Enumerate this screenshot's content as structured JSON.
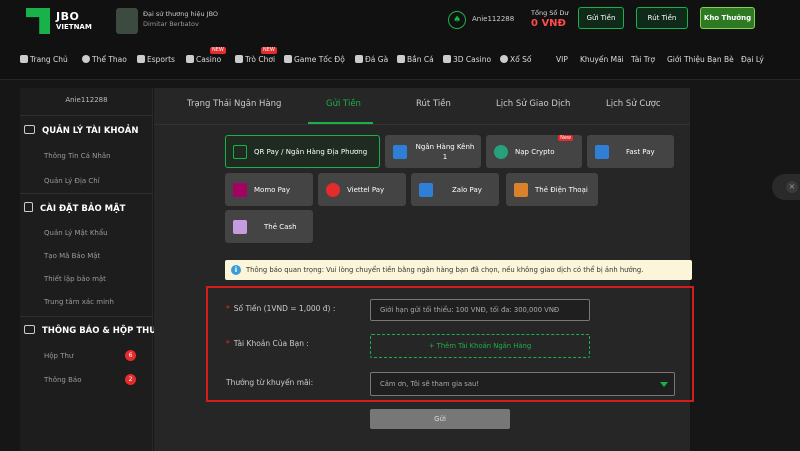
{
  "header": {
    "logo_line1": "JBO",
    "logo_line2": "VIETNAM",
    "ambassador_line1": "Đại sứ thương hiệu JBO",
    "ambassador_line2": "Dimitar Berbatov",
    "username": "Anie112288",
    "balance_label": "Tổng Số Dư",
    "balance_value": "0 VNĐ",
    "deposit_button": "Gửi Tiền",
    "withdraw_button": "Rút Tiền",
    "rewards_button": "Kho Thưởng"
  },
  "nav": {
    "items": [
      "Trang Chủ",
      "Thể Thao",
      "Esports",
      "Casino",
      "Trò Chơi",
      "Game Tốc Độ",
      "Đá Gà",
      "Bắn Cá",
      "3D Casino",
      "Xổ Số",
      "VIP",
      "Khuyến Mãi",
      "Tài Trợ",
      "Giới Thiệu Bạn Bè",
      "Đại Lý"
    ],
    "new_badge": "NEW"
  },
  "sidebar": {
    "username": "Anie112288",
    "section1": "QUẢN LÝ TÀI KHOẢN",
    "section1_items": [
      "Thông Tin Cá Nhân",
      "Quản Lý Địa Chỉ"
    ],
    "section2": "CÀI ĐẶT BẢO MẬT",
    "section2_items": [
      "Quản Lý Mật Khẩu",
      "Tạo Mã Bảo Mật",
      "Thiết lập bảo mật",
      "Trung tâm xác minh"
    ],
    "section3": "THÔNG BÁO & HỘP THƯ",
    "section3_items": [
      "Hộp Thư",
      "Thông Báo"
    ],
    "inbox_count": "6",
    "notice_count": "2"
  },
  "tabs": [
    "Trạng Thái Ngân Hàng",
    "Gửi Tiền",
    "Rút Tiền",
    "Lịch Sử Giao Dịch",
    "Lịch Sử Cược"
  ],
  "payment_methods": [
    "QR Pay / Ngân Hàng Địa Phương",
    "Ngân Hàng Kênh 1",
    "Nạp Crypto",
    "Fast Pay",
    "Momo Pay",
    "Viettel Pay",
    "Zalo Pay",
    "Thẻ Điện Thoại",
    "Thẻ Cash"
  ],
  "crypto_badge": "New",
  "notice": "Thông báo quan trọng: Vui lòng chuyển tiền bằng ngân hàng bạn đã chọn, nếu không giao dịch có thể bị ảnh hưởng.",
  "form": {
    "amount_label": "Số Tiền (1VND = 1,000 đ) :",
    "amount_placeholder": "Giới hạn gửi tối thiểu: 100 VNĐ, tối đa: 300,000 VNĐ",
    "account_label": "Tài Khoản Của Bạn :",
    "add_account": "+ Thêm Tài Khoản Ngân Hàng",
    "promo_label": "Thưởng từ khuyến mãi:",
    "promo_value": "Cảm ơn, Tôi sẽ tham gia sau!",
    "submit": "Gửi"
  },
  "colors": {
    "accent": "#19b14a",
    "alert": "#d11d1d",
    "balance": "#ff4b4b"
  }
}
